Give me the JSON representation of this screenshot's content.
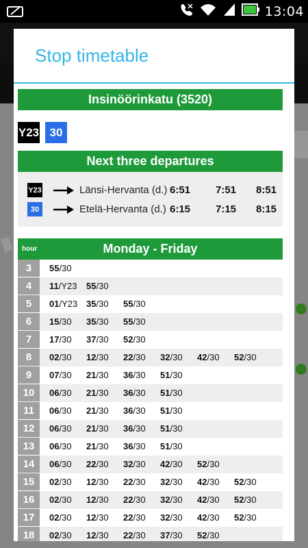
{
  "status_bar": {
    "time": "13:04",
    "icons": [
      "screenshot-icon",
      "mute-icon",
      "wifi-icon",
      "signal-icon",
      "battery-icon"
    ]
  },
  "dialog": {
    "title": "Stop timetable",
    "stop_name": "Insinöörinkatu (3520)",
    "lines": [
      {
        "label": "Y23",
        "color": "#000000"
      },
      {
        "label": "30",
        "color": "#2a6ee6"
      }
    ],
    "next_departures": {
      "title": "Next three departures",
      "rows": [
        {
          "line": "Y23",
          "color": "#000000",
          "destination": "Länsi-Hervanta (d.)",
          "times": [
            "6:51",
            "7:51",
            "8:51"
          ]
        },
        {
          "line": "30",
          "color": "#2a6ee6",
          "destination": "Etelä-Hervanta (d.)",
          "times": [
            "6:15",
            "7:15",
            "8:15"
          ]
        }
      ]
    },
    "timetable": {
      "hour_label": "hour",
      "day_label": "Monday - Friday",
      "rows": [
        {
          "hour": "3",
          "deps": [
            [
              "55",
              "30"
            ]
          ]
        },
        {
          "hour": "4",
          "deps": [
            [
              "11",
              "Y23"
            ],
            [
              "55",
              "30"
            ]
          ]
        },
        {
          "hour": "5",
          "deps": [
            [
              "01",
              "Y23"
            ],
            [
              "35",
              "30"
            ],
            [
              "55",
              "30"
            ]
          ]
        },
        {
          "hour": "6",
          "deps": [
            [
              "15",
              "30"
            ],
            [
              "35",
              "30"
            ],
            [
              "55",
              "30"
            ]
          ]
        },
        {
          "hour": "7",
          "deps": [
            [
              "17",
              "30"
            ],
            [
              "37",
              "30"
            ],
            [
              "52",
              "30"
            ]
          ]
        },
        {
          "hour": "8",
          "deps": [
            [
              "02",
              "30"
            ],
            [
              "12",
              "30"
            ],
            [
              "22",
              "30"
            ],
            [
              "32",
              "30"
            ],
            [
              "42",
              "30"
            ],
            [
              "52",
              "30"
            ]
          ]
        },
        {
          "hour": "9",
          "deps": [
            [
              "07",
              "30"
            ],
            [
              "21",
              "30"
            ],
            [
              "36",
              "30"
            ],
            [
              "51",
              "30"
            ]
          ]
        },
        {
          "hour": "10",
          "deps": [
            [
              "06",
              "30"
            ],
            [
              "21",
              "30"
            ],
            [
              "36",
              "30"
            ],
            [
              "51",
              "30"
            ]
          ]
        },
        {
          "hour": "11",
          "deps": [
            [
              "06",
              "30"
            ],
            [
              "21",
              "30"
            ],
            [
              "36",
              "30"
            ],
            [
              "51",
              "30"
            ]
          ]
        },
        {
          "hour": "12",
          "deps": [
            [
              "06",
              "30"
            ],
            [
              "21",
              "30"
            ],
            [
              "36",
              "30"
            ],
            [
              "51",
              "30"
            ]
          ]
        },
        {
          "hour": "13",
          "deps": [
            [
              "06",
              "30"
            ],
            [
              "21",
              "30"
            ],
            [
              "36",
              "30"
            ],
            [
              "51",
              "30"
            ]
          ]
        },
        {
          "hour": "14",
          "deps": [
            [
              "06",
              "30"
            ],
            [
              "22",
              "30"
            ],
            [
              "32",
              "30"
            ],
            [
              "42",
              "30"
            ],
            [
              "52",
              "30"
            ]
          ]
        },
        {
          "hour": "15",
          "deps": [
            [
              "02",
              "30"
            ],
            [
              "12",
              "30"
            ],
            [
              "22",
              "30"
            ],
            [
              "32",
              "30"
            ],
            [
              "42",
              "30"
            ],
            [
              "52",
              "30"
            ]
          ]
        },
        {
          "hour": "16",
          "deps": [
            [
              "02",
              "30"
            ],
            [
              "12",
              "30"
            ],
            [
              "22",
              "30"
            ],
            [
              "32",
              "30"
            ],
            [
              "42",
              "30"
            ],
            [
              "52",
              "30"
            ]
          ]
        },
        {
          "hour": "17",
          "deps": [
            [
              "02",
              "30"
            ],
            [
              "12",
              "30"
            ],
            [
              "22",
              "30"
            ],
            [
              "32",
              "30"
            ],
            [
              "42",
              "30"
            ],
            [
              "52",
              "30"
            ]
          ]
        },
        {
          "hour": "18",
          "deps": [
            [
              "02",
              "30"
            ],
            [
              "12",
              "30"
            ],
            [
              "22",
              "30"
            ],
            [
              "37",
              "30"
            ],
            [
              "52",
              "30"
            ]
          ]
        }
      ]
    }
  },
  "colors": {
    "accent": "#33b5e5",
    "header_green": "#1e9a3a",
    "hour_gray": "#a0a0a0",
    "row_alt": "#eeeeee"
  }
}
